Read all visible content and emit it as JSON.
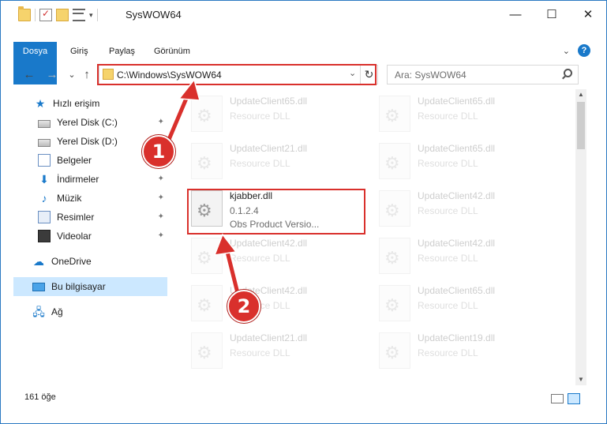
{
  "window": {
    "title": "SysWOW64",
    "controls": {
      "minimize": "—",
      "maximize": "☐",
      "close": "✕"
    }
  },
  "ribbon": {
    "tabs": [
      "Dosya",
      "Giriş",
      "Paylaş",
      "Görünüm"
    ],
    "collapse_glyph": "⌄",
    "help_glyph": "?"
  },
  "navigation": {
    "back": "←",
    "forward": "→",
    "recent": "⌄",
    "up": "↑"
  },
  "address_bar": {
    "path": "C:\\Windows\\SysWOW64",
    "dropdown": "⌄",
    "refresh": "↻"
  },
  "search": {
    "placeholder": "Ara: SysWOW64"
  },
  "sidebar": {
    "items": [
      {
        "label": "Hızlı erişim",
        "icon": "star-icon",
        "pinned": false
      },
      {
        "label": "Yerel Disk (C:)",
        "icon": "drive-icon",
        "pinned": true
      },
      {
        "label": "Yerel Disk (D:)",
        "icon": "drive-icon",
        "pinned": false
      },
      {
        "label": "Belgeler",
        "icon": "documents-icon",
        "pinned": true
      },
      {
        "label": "İndirmeler",
        "icon": "downloads-icon",
        "pinned": true
      },
      {
        "label": "Müzik",
        "icon": "music-icon",
        "pinned": true
      },
      {
        "label": "Resimler",
        "icon": "pictures-icon",
        "pinned": true
      },
      {
        "label": "Videolar",
        "icon": "videos-icon",
        "pinned": true
      },
      {
        "label": "OneDrive",
        "icon": "onedrive-icon",
        "pinned": false
      },
      {
        "label": "Bu bilgisayar",
        "icon": "this-pc-icon",
        "pinned": false,
        "selected": true
      },
      {
        "label": "Ağ",
        "icon": "network-icon",
        "pinned": false
      }
    ],
    "pin_glyph": "📌"
  },
  "files": {
    "left": [
      {
        "name": "UpdateClient65.dll",
        "line1": "Resource DLL",
        "line2": ""
      },
      {
        "name": "UpdateClient21.dll",
        "line1": "Resource DLL",
        "line2": ""
      },
      {
        "name": "kjabber.dll",
        "line1": "0.1.2.4",
        "line2": "Obs  Product Versio..."
      },
      {
        "name": "UpdateClient42.dll",
        "line1": "Resource DLL",
        "line2": ""
      },
      {
        "name": "UpdateClient42.dll",
        "line1": "Resource DLL",
        "line2": ""
      },
      {
        "name": "UpdateClient21.dll",
        "line1": "Resource DLL",
        "line2": ""
      }
    ],
    "right": [
      {
        "name": "UpdateClient65.dll",
        "line1": "Resource DLL",
        "line2": ""
      },
      {
        "name": "UpdateClient65.dll",
        "line1": "Resource DLL",
        "line2": ""
      },
      {
        "name": "UpdateClient42.dll",
        "line1": "Resource DLL",
        "line2": ""
      },
      {
        "name": "UpdateClient42.dll",
        "line1": "Resource DLL",
        "line2": ""
      },
      {
        "name": "UpdateClient65.dll",
        "line1": "Resource DLL",
        "line2": ""
      },
      {
        "name": "UpdateClient19.dll",
        "line1": "Resource DLL",
        "line2": ""
      }
    ]
  },
  "status_bar": {
    "item_count": "161 öğe"
  },
  "annotations": {
    "badge1": "1",
    "badge2": "2",
    "color": "#d9302c"
  }
}
